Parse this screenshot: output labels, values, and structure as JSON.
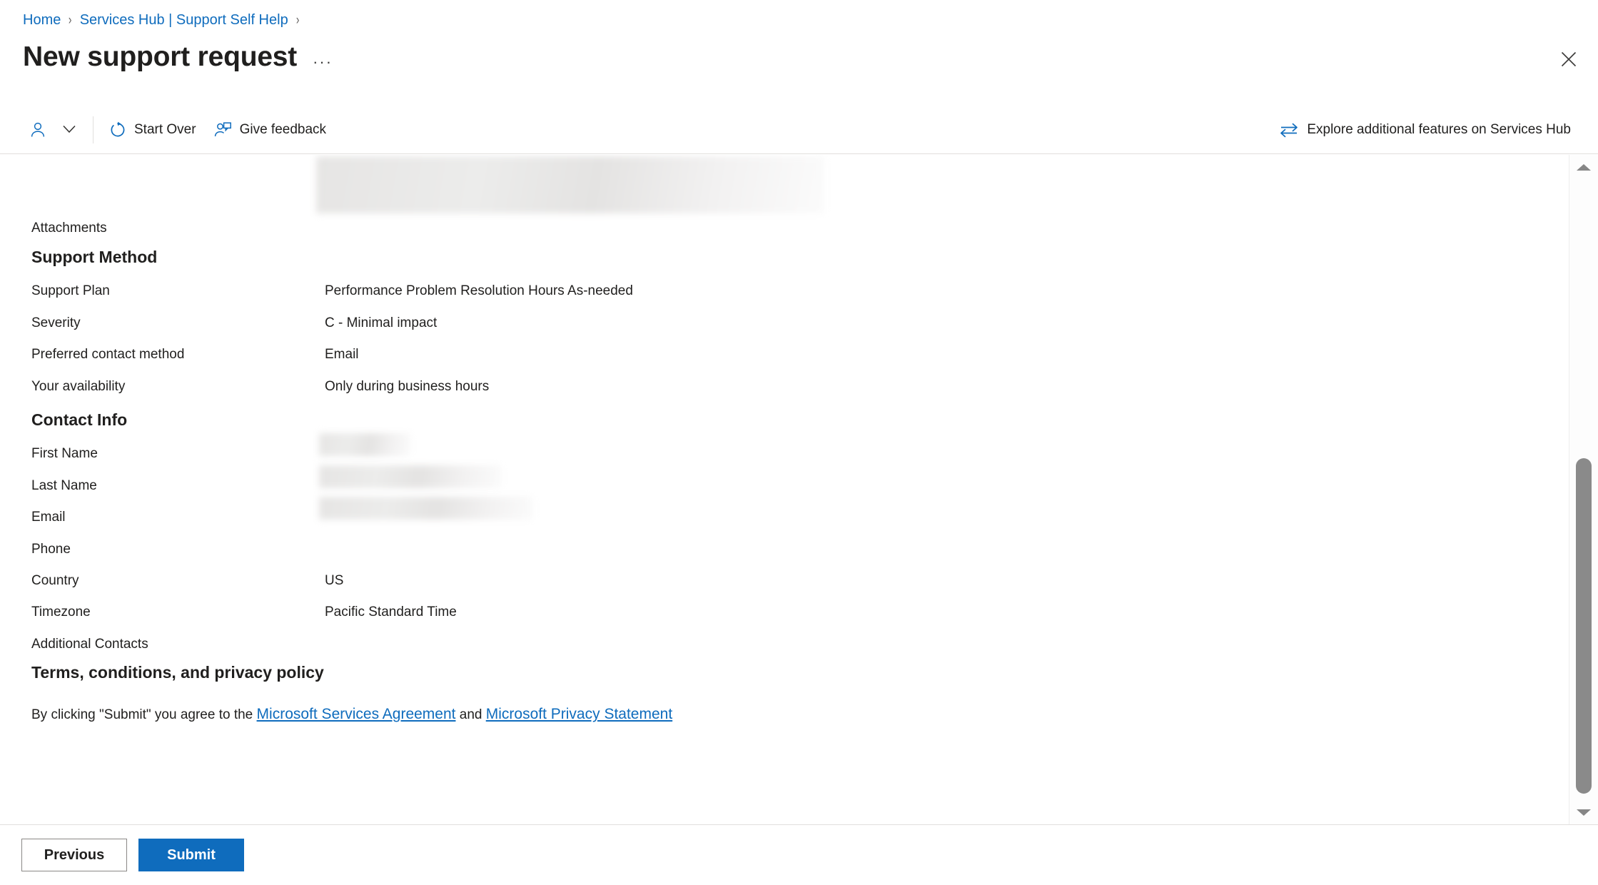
{
  "breadcrumb": {
    "items": [
      {
        "label": "Home"
      },
      {
        "label": "Services Hub | Support Self Help"
      }
    ],
    "separator": "›"
  },
  "header": {
    "title": "New support request",
    "overflow_label": "···",
    "close_label": "Close"
  },
  "commandbar": {
    "persona_icon": "person-icon",
    "persona_chevron": "chevron-down-icon",
    "start_over": {
      "label": "Start Over",
      "icon": "refresh-icon"
    },
    "give_feedback": {
      "label": "Give feedback",
      "icon": "person-feedback-icon"
    },
    "explore": {
      "label": "Explore additional features on Services Hub",
      "icon": "two-way-arrows-icon"
    }
  },
  "form": {
    "attachments_label": "Attachments",
    "attachments_value": "",
    "sections": [
      {
        "heading": "Support Method",
        "rows": [
          {
            "label": "Support Plan",
            "value": "Performance Problem Resolution Hours As-needed"
          },
          {
            "label": "Severity",
            "value": "C - Minimal impact"
          },
          {
            "label": "Preferred contact method",
            "value": "Email"
          },
          {
            "label": "Your availability",
            "value": "Only during business hours"
          }
        ]
      },
      {
        "heading": "Contact Info",
        "rows": [
          {
            "label": "First Name",
            "value": "",
            "redacted": true,
            "redact_width": 92
          },
          {
            "label": "Last Name",
            "value": "",
            "redacted": true,
            "redact_width": 256
          },
          {
            "label": "Email",
            "value": "",
            "redacted": true,
            "redact_width": 300
          },
          {
            "label": "Phone",
            "value": ""
          },
          {
            "label": "Country",
            "value": "US"
          },
          {
            "label": "Timezone",
            "value": "Pacific Standard Time"
          },
          {
            "label": "Additional Contacts",
            "value": ""
          }
        ]
      }
    ],
    "terms": {
      "heading": "Terms, conditions, and privacy policy",
      "prefix": "By clicking \"Submit\" you agree to the ",
      "link1": "Microsoft Services Agreement",
      "middle": " and ",
      "link2": "Microsoft Privacy Statement"
    }
  },
  "footer": {
    "previous_label": "Previous",
    "submit_label": "Submit"
  },
  "scrollbar": {
    "up_arrow": "scroll-up-arrow",
    "down_arrow": "scroll-down-arrow"
  },
  "colors": {
    "link": "#0f6cbd",
    "primary_button": "#0f6cbd",
    "text": "#201f1e",
    "divider": "#e1dfdd"
  }
}
